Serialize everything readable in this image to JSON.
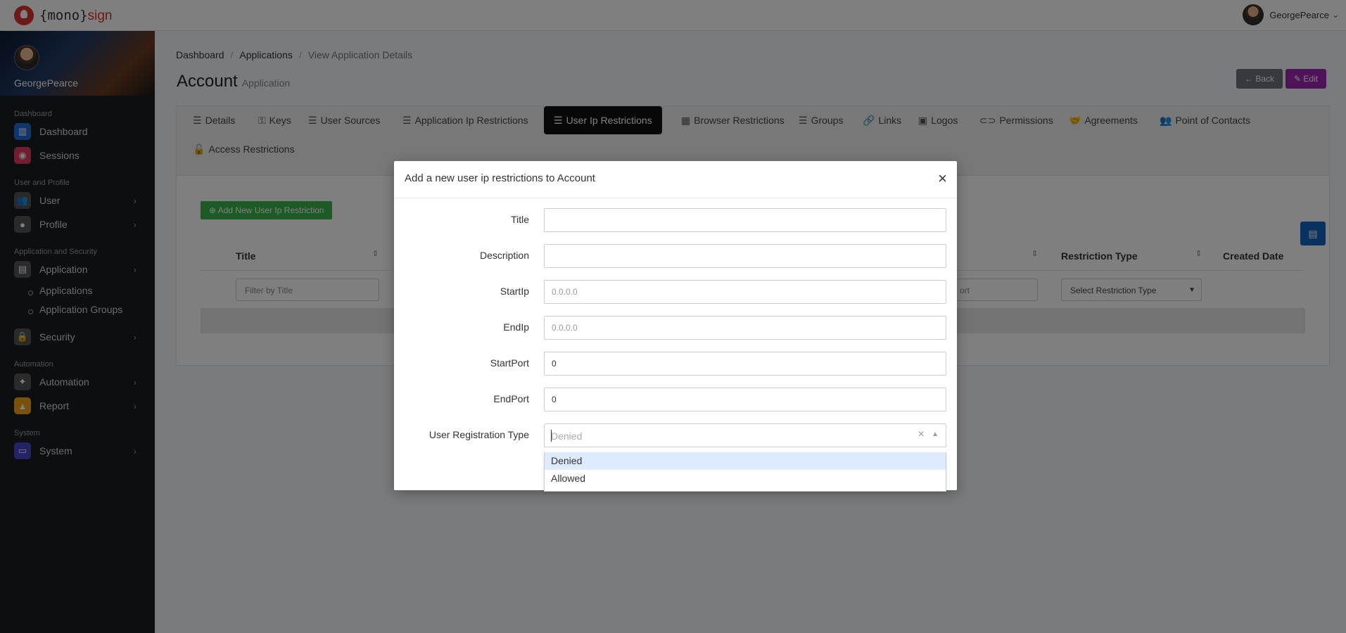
{
  "brand": {
    "prefix": "{mono}",
    "accent": "sign"
  },
  "user": {
    "name": "GeorgePearce"
  },
  "sidebar": {
    "sections": [
      {
        "title": "Dashboard"
      },
      {
        "title": "User and Profile"
      },
      {
        "title": "Application and Security"
      },
      {
        "title": "Automation"
      },
      {
        "title": "System"
      }
    ],
    "items": {
      "dashboard": "Dashboard",
      "sessions": "Sessions",
      "user": "User",
      "profile": "Profile",
      "application": "Application",
      "applications": "Applications",
      "application_groups": "Application Groups",
      "security": "Security",
      "automation": "Automation",
      "report": "Report",
      "system": "System"
    }
  },
  "breadcrumb": [
    "Dashboard",
    "Applications",
    "View Application Details"
  ],
  "page": {
    "title": "Account",
    "subtitle": "Application"
  },
  "actions": {
    "back": "← Back",
    "edit": "Edit"
  },
  "tabs": [
    "Details",
    "Keys",
    "User Sources",
    "Application Ip Restrictions",
    "User Ip Restrictions",
    "Browser Restrictions",
    "Groups",
    "Links",
    "Logos",
    "Permissions",
    "Agreements",
    "Point of Contacts",
    "Access Restrictions"
  ],
  "table": {
    "add_button": "Add New User Ip Restriction",
    "columns": {
      "title": "Title",
      "restriction_type": "Restriction Type",
      "created_date": "Created Date"
    },
    "filters": {
      "title": "Filter by Title",
      "port": "ort",
      "restriction_type": "Select Restriction Type"
    }
  },
  "modal": {
    "title": "Add a new user ip restrictions to Account",
    "fields": {
      "title": {
        "label": "Title",
        "value": ""
      },
      "description": {
        "label": "Description",
        "value": ""
      },
      "start_ip": {
        "label": "StartIp",
        "placeholder": "0.0.0.0"
      },
      "end_ip": {
        "label": "EndIp",
        "placeholder": "0.0.0.0"
      },
      "start_port": {
        "label": "StartPort",
        "value": "0"
      },
      "end_port": {
        "label": "EndPort",
        "value": "0"
      },
      "registration_type": {
        "label": "User Registration Type",
        "placeholder": "Denied",
        "options": [
          "Denied",
          "Allowed"
        ]
      }
    }
  },
  "colors": {
    "brand": "#d9322e",
    "active_tab": "#111111",
    "add_button": "#3ab54a",
    "edit_button": "#9c27b0",
    "back_button": "#6c757d",
    "excel_button": "#1565c0",
    "option_highlight": "#deebff"
  }
}
